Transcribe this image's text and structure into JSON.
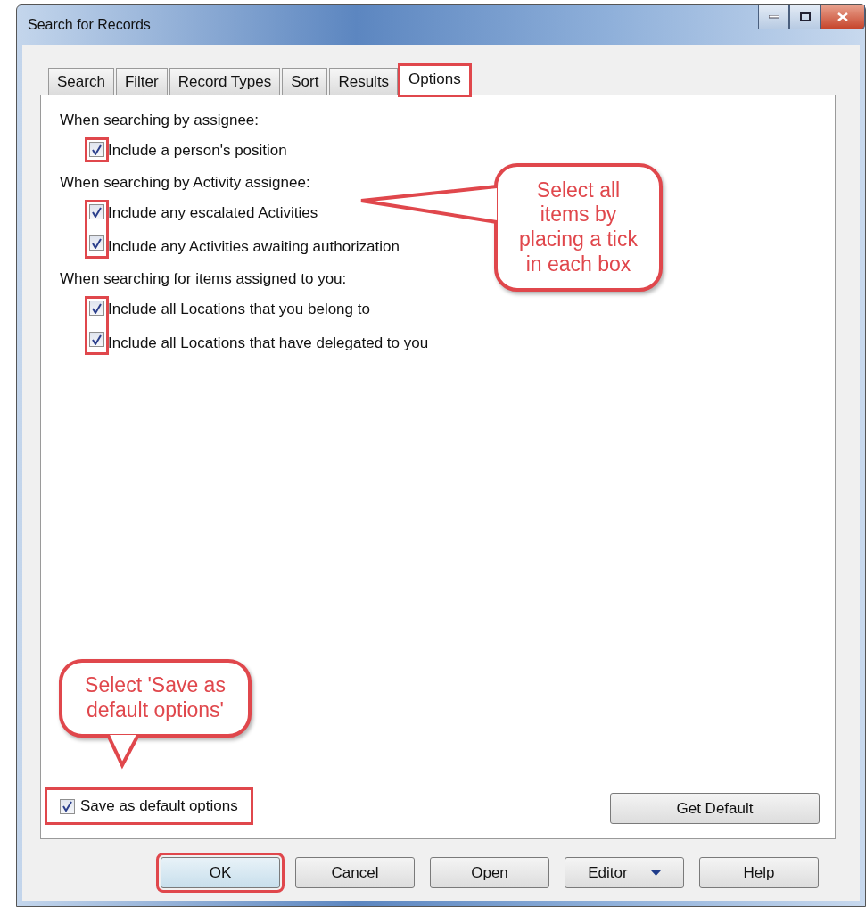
{
  "window": {
    "title": "Search for Records"
  },
  "tabs": [
    {
      "label": "Search",
      "selected": false,
      "highlighted": false
    },
    {
      "label": "Filter",
      "selected": false,
      "highlighted": false
    },
    {
      "label": "Record Types",
      "selected": false,
      "highlighted": false
    },
    {
      "label": "Sort",
      "selected": false,
      "highlighted": false
    },
    {
      "label": "Results",
      "selected": false,
      "highlighted": false
    },
    {
      "label": "Options",
      "selected": true,
      "highlighted": true
    }
  ],
  "groups": [
    {
      "heading": "When searching by assignee:",
      "highlighted": true,
      "options": [
        {
          "label": "Include a person's position",
          "checked": true
        }
      ]
    },
    {
      "heading": "When searching by Activity assignee:",
      "highlighted": true,
      "options": [
        {
          "label": "Include any escalated Activities",
          "checked": true
        },
        {
          "label": "Include any Activities awaiting authorization",
          "checked": true
        }
      ]
    },
    {
      "heading": "When searching for items assigned to you:",
      "highlighted": true,
      "options": [
        {
          "label": "Include all Locations that you belong to",
          "checked": true
        },
        {
          "label": "Include all Locations that have delegated to you",
          "checked": true
        }
      ]
    }
  ],
  "save_default": {
    "label": "Save as default options",
    "checked": true,
    "highlighted": true
  },
  "get_default_button": {
    "label": "Get Default"
  },
  "buttons": [
    {
      "label": "OK",
      "kind": "button",
      "highlighted": true
    },
    {
      "label": "Cancel",
      "kind": "button",
      "highlighted": false
    },
    {
      "label": "Open",
      "kind": "button",
      "highlighted": false
    },
    {
      "label": "Editor",
      "kind": "split",
      "highlighted": false
    },
    {
      "label": "Help",
      "kind": "button",
      "highlighted": false
    }
  ],
  "callouts": [
    {
      "text": "Select all items by placing a tick in each box",
      "kind": "side"
    },
    {
      "text": "Select 'Save as default options'",
      "kind": "bottom"
    }
  ]
}
